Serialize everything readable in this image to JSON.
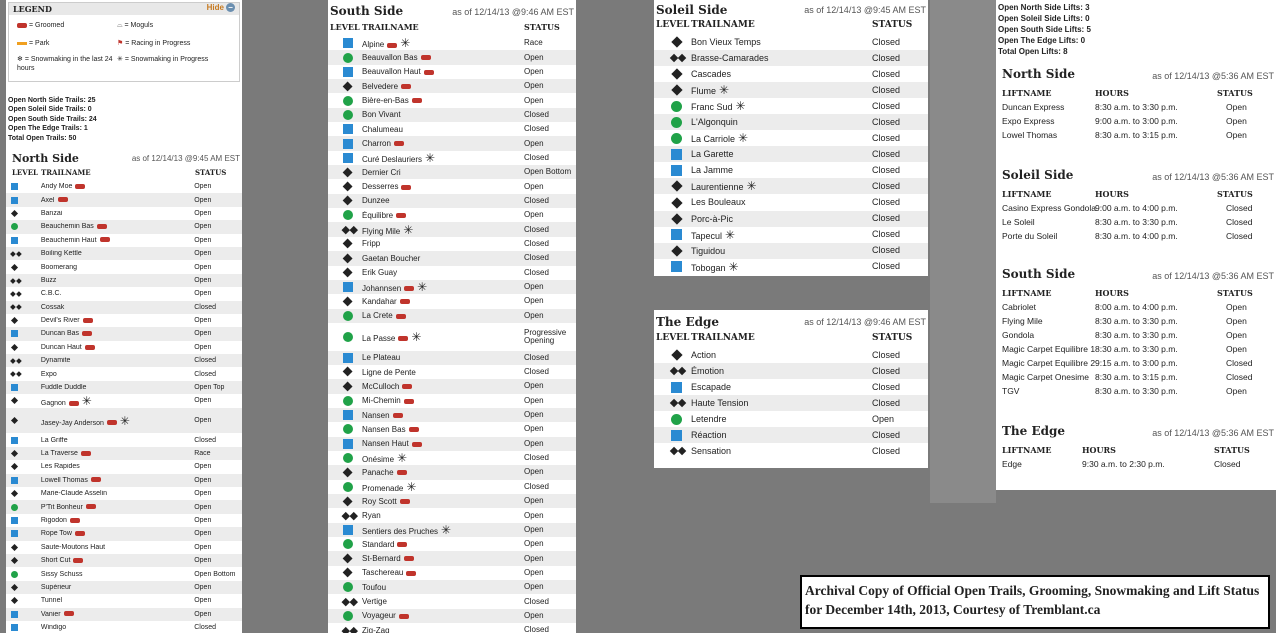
{
  "legend": {
    "title": "LEGEND",
    "hide": "Hide",
    "items": [
      "= Groomed",
      "= Moguls",
      "= Park",
      "= Racing in Progress",
      "= Snowmaking in the last 24 hours",
      "= Snowmaking in Progress"
    ]
  },
  "trail_summary": [
    "Open North Side Trails: 25",
    "Open Soleil Side Trails: 0",
    "Open South Side Trails: 24",
    "Open The Edge Trails: 1",
    "Total Open Trails: 50"
  ],
  "headers": {
    "level": "LEVEL",
    "trailname": "TRAILNAME",
    "status": "STATUS",
    "liftname": "LIFTNAME",
    "hours": "HOURS"
  },
  "north": {
    "title": "North Side",
    "asof": "as of 12/14/13 @9:45 AM EST",
    "trails": [
      {
        "l": "s",
        "n": "Andy Moe",
        "g": 1,
        "st": "Open"
      },
      {
        "l": "s",
        "n": "Axel",
        "g": 1,
        "st": "Open"
      },
      {
        "l": "d",
        "n": "Banzai",
        "st": "Open"
      },
      {
        "l": "c",
        "n": "Beauchemin Bas",
        "g": 1,
        "st": "Open"
      },
      {
        "l": "s",
        "n": "Beauchemin Haut",
        "g": 1,
        "st": "Open"
      },
      {
        "l": "dd",
        "n": "Boiling Kettle",
        "st": "Open"
      },
      {
        "l": "d",
        "n": "Boomerang",
        "st": "Open"
      },
      {
        "l": "dd",
        "n": "Buzz",
        "st": "Open"
      },
      {
        "l": "dd",
        "n": "C.B.C.",
        "st": "Open"
      },
      {
        "l": "dd",
        "n": "Cossak",
        "st": "Closed"
      },
      {
        "l": "d",
        "n": "Devil's River",
        "g": 1,
        "st": "Open"
      },
      {
        "l": "s",
        "n": "Duncan Bas",
        "g": 1,
        "st": "Open"
      },
      {
        "l": "d",
        "n": "Duncan Haut",
        "g": 1,
        "st": "Open"
      },
      {
        "l": "dd",
        "n": "Dynamite",
        "st": "Closed"
      },
      {
        "l": "dd",
        "n": "Expo",
        "st": "Closed"
      },
      {
        "l": "s",
        "n": "Fuddle Duddle",
        "st": "Open Top"
      },
      {
        "l": "d",
        "n": "Gagnon",
        "g": 1,
        "s": 1,
        "st": "Open"
      },
      {
        "l": "d",
        "n": "Jasey-Jay Anderson",
        "g": 1,
        "s": 1,
        "st": "Open",
        "tall": 1
      },
      {
        "l": "s",
        "n": "La Griffe",
        "st": "Closed"
      },
      {
        "l": "d",
        "n": "La Traverse",
        "g": 1,
        "st": "Race"
      },
      {
        "l": "d",
        "n": "Les Rapides",
        "st": "Open"
      },
      {
        "l": "s",
        "n": "Lowell Thomas",
        "g": 1,
        "st": "Open"
      },
      {
        "l": "d",
        "n": "Marie-Claude Asselin",
        "st": "Open"
      },
      {
        "l": "c",
        "n": "P'Tit Bonheur",
        "g": 1,
        "st": "Open"
      },
      {
        "l": "s",
        "n": "Rigodon",
        "g": 1,
        "st": "Open"
      },
      {
        "l": "s",
        "n": "Rope Tow",
        "g": 1,
        "st": "Open"
      },
      {
        "l": "d",
        "n": "Saute-Moutons Haut",
        "st": "Open"
      },
      {
        "l": "d",
        "n": "Short Cut",
        "g": 1,
        "st": "Open"
      },
      {
        "l": "c",
        "n": "Sissy Schuss",
        "st": "Open Bottom"
      },
      {
        "l": "d",
        "n": "Supérieur",
        "st": "Open"
      },
      {
        "l": "d",
        "n": "Tunnel",
        "st": "Open"
      },
      {
        "l": "s",
        "n": "Vanier",
        "g": 1,
        "st": "Open"
      },
      {
        "l": "s",
        "n": "Windigo",
        "st": "Closed"
      }
    ]
  },
  "south": {
    "title": "South Side",
    "asof": "as of 12/14/13 @9:46 AM EST",
    "trails": [
      {
        "l": "s",
        "n": "Alpine",
        "g": 1,
        "s": 1,
        "st": "Race"
      },
      {
        "l": "c",
        "n": "Beauvallon Bas",
        "g": 1,
        "st": "Open"
      },
      {
        "l": "s",
        "n": "Beauvallon Haut",
        "g": 1,
        "st": "Open"
      },
      {
        "l": "d",
        "n": "Belvedere",
        "g": 1,
        "st": "Open"
      },
      {
        "l": "c",
        "n": "Bière-en-Bas",
        "g": 1,
        "st": "Open"
      },
      {
        "l": "c",
        "n": "Bon Vivant",
        "st": "Closed"
      },
      {
        "l": "s",
        "n": "Chalumeau",
        "st": "Closed"
      },
      {
        "l": "s",
        "n": "Charron",
        "g": 1,
        "st": "Open"
      },
      {
        "l": "s",
        "n": "Curé Deslauriers",
        "s": 1,
        "st": "Closed"
      },
      {
        "l": "d",
        "n": "Dernier Cri",
        "st": "Open Bottom"
      },
      {
        "l": "d",
        "n": "Desserres",
        "g": 1,
        "st": "Open"
      },
      {
        "l": "d",
        "n": "Dunzee",
        "st": "Closed"
      },
      {
        "l": "c",
        "n": "Équilibre",
        "g": 1,
        "st": "Open"
      },
      {
        "l": "dd",
        "n": "Flying Mile",
        "s": 1,
        "st": "Closed"
      },
      {
        "l": "d",
        "n": "Fripp",
        "st": "Closed"
      },
      {
        "l": "d",
        "n": "Gaetan Boucher",
        "st": "Closed"
      },
      {
        "l": "d",
        "n": "Erik Guay",
        "st": "Closed"
      },
      {
        "l": "s",
        "n": "Johannsen",
        "g": 1,
        "s": 1,
        "st": "Open"
      },
      {
        "l": "d",
        "n": "Kandahar",
        "g": 1,
        "st": "Open"
      },
      {
        "l": "c",
        "n": "La Crete",
        "g": 1,
        "st": "Open"
      },
      {
        "l": "c",
        "n": "La Passe",
        "g": 1,
        "s": 1,
        "st": "Progressive Opening",
        "tall": 1
      },
      {
        "l": "s",
        "n": "Le Plateau",
        "st": "Closed"
      },
      {
        "l": "d",
        "n": "Ligne de Pente",
        "st": "Closed"
      },
      {
        "l": "d",
        "n": "McCulloch",
        "g": 1,
        "st": "Open"
      },
      {
        "l": "c",
        "n": "Mi-Chemin",
        "g": 1,
        "st": "Open"
      },
      {
        "l": "s",
        "n": "Nansen",
        "g": 1,
        "st": "Open"
      },
      {
        "l": "c",
        "n": "Nansen Bas",
        "g": 1,
        "st": "Open"
      },
      {
        "l": "s",
        "n": "Nansen Haut",
        "g": 1,
        "st": "Open"
      },
      {
        "l": "c",
        "n": "Onésime",
        "s": 1,
        "st": "Closed"
      },
      {
        "l": "d",
        "n": "Panache",
        "g": 1,
        "st": "Open"
      },
      {
        "l": "c",
        "n": "Promenade",
        "s": 1,
        "st": "Closed"
      },
      {
        "l": "d",
        "n": "Roy Scott",
        "g": 1,
        "st": "Open"
      },
      {
        "l": "dd",
        "n": "Ryan",
        "st": "Open"
      },
      {
        "l": "s",
        "n": "Sentiers des Pruches",
        "s": 1,
        "st": "Open"
      },
      {
        "l": "c",
        "n": "Standard",
        "g": 1,
        "st": "Open"
      },
      {
        "l": "d",
        "n": "St-Bernard",
        "g": 1,
        "st": "Open"
      },
      {
        "l": "d",
        "n": "Taschereau",
        "g": 1,
        "st": "Open"
      },
      {
        "l": "c",
        "n": "Toufou",
        "st": "Open"
      },
      {
        "l": "dd",
        "n": "Vertige",
        "st": "Closed"
      },
      {
        "l": "c",
        "n": "Voyageur",
        "g": 1,
        "st": "Open"
      },
      {
        "l": "dd",
        "n": "Zig-Zag",
        "st": "Closed"
      }
    ]
  },
  "soleil": {
    "title": "Soleil Side",
    "asof": "as of 12/14/13 @9:45 AM EST",
    "trails": [
      {
        "l": "d",
        "n": "Bon Vieux Temps",
        "st": "Closed"
      },
      {
        "l": "dd",
        "n": "Brasse-Camarades",
        "st": "Closed"
      },
      {
        "l": "d",
        "n": "Cascades",
        "st": "Closed"
      },
      {
        "l": "d",
        "n": "Flume",
        "s": 1,
        "st": "Closed"
      },
      {
        "l": "c",
        "n": "Franc Sud",
        "s": 1,
        "st": "Closed"
      },
      {
        "l": "c",
        "n": "L'Algonquin",
        "st": "Closed"
      },
      {
        "l": "c",
        "n": "La Carriole",
        "s": 1,
        "st": "Closed"
      },
      {
        "l": "s",
        "n": "La Garette",
        "st": "Closed"
      },
      {
        "l": "s",
        "n": "La Jamme",
        "st": "Closed"
      },
      {
        "l": "d",
        "n": "Laurentienne",
        "s": 1,
        "st": "Closed"
      },
      {
        "l": "d",
        "n": "Les Bouleaux",
        "st": "Closed"
      },
      {
        "l": "d",
        "n": "Porc-à-Pic",
        "st": "Closed"
      },
      {
        "l": "s",
        "n": "Tapecul",
        "s": 1,
        "st": "Closed"
      },
      {
        "l": "d",
        "n": "Tiguidou",
        "st": "Closed"
      },
      {
        "l": "s",
        "n": "Tobogan",
        "s": 1,
        "st": "Closed"
      }
    ]
  },
  "edge": {
    "title": "The Edge",
    "asof": "as of 12/14/13 @9:46 AM EST",
    "trails": [
      {
        "l": "d",
        "n": "Action",
        "st": "Closed"
      },
      {
        "l": "dd",
        "n": "Émotion",
        "st": "Closed"
      },
      {
        "l": "s",
        "n": "Escapade",
        "st": "Closed"
      },
      {
        "l": "dd",
        "n": "Haute Tension",
        "st": "Closed"
      },
      {
        "l": "c",
        "n": "Letendre",
        "st": "Open"
      },
      {
        "l": "s",
        "n": "Réaction",
        "st": "Closed"
      },
      {
        "l": "dd",
        "n": "Sensation",
        "st": "Closed"
      }
    ]
  },
  "lift_summary": [
    "Open North Side Lifts: 3",
    "Open Soleil Side Lifts: 0",
    "Open South Side Lifts: 5",
    "Open The Edge Lifts: 0",
    "Total Open Lifts: 8"
  ],
  "lifts": [
    {
      "title": "North Side",
      "asof": "as of 12/14/13 @5:36 AM EST",
      "rows": [
        {
          "n": "Duncan Express",
          "h": "8:30 a.m. to 3:30 p.m.",
          "st": "Open"
        },
        {
          "n": "Expo Express",
          "h": "9:00 a.m. to 3:00 p.m.",
          "st": "Open"
        },
        {
          "n": "Lowel Thomas",
          "h": "8:30 a.m. to 3:15 p.m.",
          "st": "Open"
        }
      ]
    },
    {
      "title": "Soleil Side",
      "asof": "as of 12/14/13 @5:36 AM EST",
      "rows": [
        {
          "n": "Casino Express Gondola",
          "h": "9:00 a.m. to 4:00 p.m.",
          "st": "Closed"
        },
        {
          "n": "Le Soleil",
          "h": "8:30 a.m. to 3:30 p.m.",
          "st": "Closed"
        },
        {
          "n": "Porte du Soleil",
          "h": "8:30 a.m. to 4:00 p.m.",
          "st": "Closed"
        }
      ]
    },
    {
      "title": "South Side",
      "asof": "as of 12/14/13 @5:36 AM EST",
      "rows": [
        {
          "n": "Cabriolet",
          "h": "8:00 a.m. to 4:00 p.m.",
          "st": "Open"
        },
        {
          "n": "Flying Mile",
          "h": "8:30 a.m. to 3:30 p.m.",
          "st": "Open"
        },
        {
          "n": "Gondola",
          "h": "8:30 a.m. to 3:30 p.m.",
          "st": "Open"
        },
        {
          "n": "Magic Carpet Equilibre 1",
          "h": "8:30 a.m. to 3:30 p.m.",
          "st": "Open"
        },
        {
          "n": "Magic Carpet Equilibre 2",
          "h": "9:15 a.m. to 3:00 p.m.",
          "st": "Closed"
        },
        {
          "n": "Magic Carpet Onesime",
          "h": "8:30 a.m. to 3:15 p.m.",
          "st": "Closed"
        },
        {
          "n": "TGV",
          "h": "8:30 a.m. to 3:30 p.m.",
          "st": "Open"
        }
      ]
    },
    {
      "title": "The Edge",
      "asof": "as of 12/14/13 @5:36 AM EST",
      "rows": [
        {
          "n": "Edge",
          "h": "9:30 a.m. to 2:30 p.m.",
          "st": "Closed"
        }
      ]
    }
  ],
  "caption": "Archival Copy of Official Open Trails, Grooming, Snowmaking and Lift Status for December 14th, 2013, Courtesy of Tremblant.ca"
}
